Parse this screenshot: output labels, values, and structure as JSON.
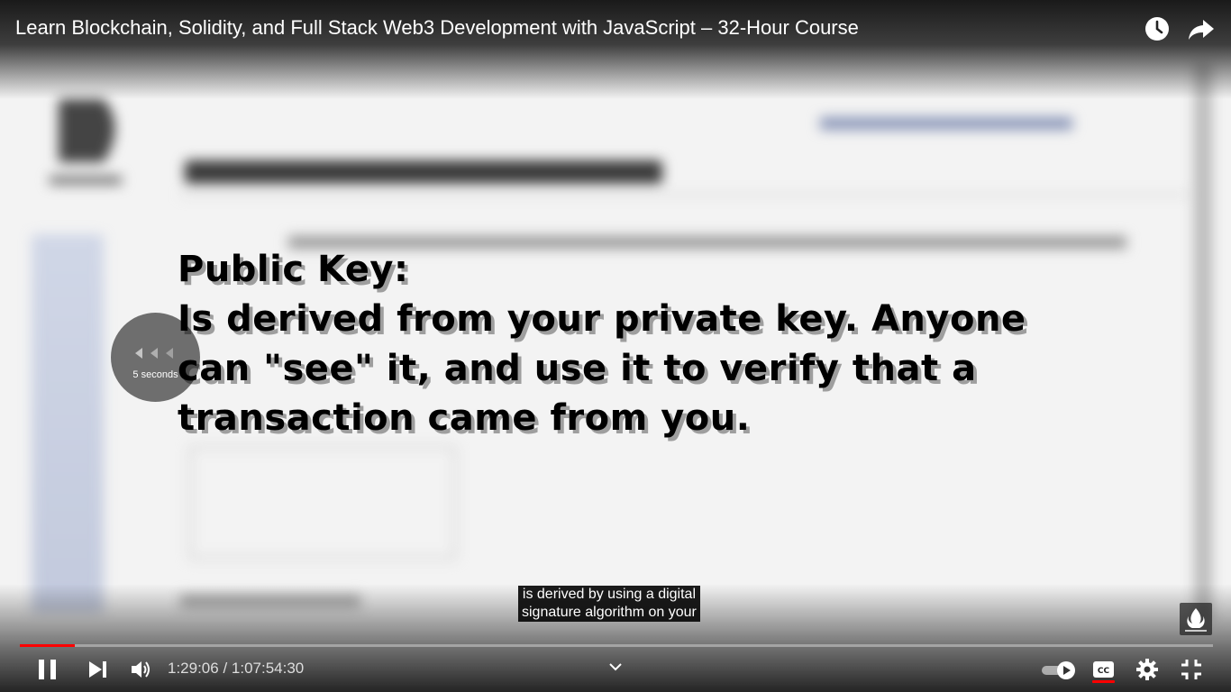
{
  "video": {
    "title": "Learn Blockchain, Solidity, and Full Stack Web3 Development with JavaScript – 32-Hour Course"
  },
  "overlay": {
    "lines": [
      "Public Key:",
      "Is derived from your private key. Anyone",
      "can \"see\" it, and use it to verify that a",
      "transaction came from you."
    ]
  },
  "seek_indicator": {
    "label": "5 seconds"
  },
  "captions": {
    "line1": "is derived by using a digital",
    "line2": "signature algorithm on your"
  },
  "player": {
    "time_display": "1:29:06 / 1:07:54:30",
    "progress_fraction": 0.046,
    "accent_color": "#ff0000"
  },
  "icons": {
    "watch_later": "clock-icon",
    "share": "share-icon",
    "pause": "pause-icon",
    "next": "next-icon",
    "volume": "volume-icon",
    "chapters": "chevron-down-icon",
    "autoplay": "autoplay-toggle",
    "captions": "cc-icon",
    "settings": "gear-icon",
    "exit_fullscreen": "exit-fullscreen-icon",
    "channel_watermark": "watermark-logo"
  }
}
